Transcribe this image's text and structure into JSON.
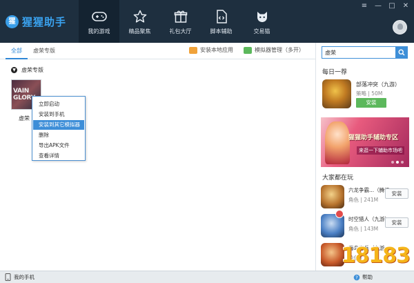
{
  "app": {
    "name": "猩猩助手",
    "logo_badge": "猩"
  },
  "nav": [
    {
      "label": "我的游戏",
      "icon": "gamepad-icon",
      "active": true
    },
    {
      "label": "精品聚焦",
      "icon": "star-icon",
      "active": false
    },
    {
      "label": "礼包大厅",
      "icon": "gift-icon",
      "active": false
    },
    {
      "label": "脚本辅助",
      "icon": "script-file-icon",
      "active": false
    },
    {
      "label": "交易猫",
      "icon": "cat-icon",
      "active": false
    }
  ],
  "window_controls": {
    "menu": "≡",
    "minimize": "—",
    "maximize": "□",
    "close": "✕"
  },
  "tabs": [
    {
      "label": "全部",
      "active": true
    },
    {
      "label": "虚荣专版",
      "active": false
    }
  ],
  "toolbar": {
    "install_local": "安装本地应用",
    "emulator_mgr": "模拟器管理（多开）"
  },
  "section": {
    "title": "虚荣专版"
  },
  "game": {
    "tile_text": "VAIN GLORY",
    "name": "虚荣"
  },
  "context_menu": [
    {
      "label": "立即启动",
      "highlighted": false
    },
    {
      "label": "安装到手机",
      "highlighted": false
    },
    {
      "label": "安装到其它模拟器",
      "highlighted": true
    },
    {
      "label": "删除",
      "highlighted": false
    },
    {
      "label": "导出APK文件",
      "highlighted": false
    },
    {
      "label": "查看详情",
      "highlighted": false
    }
  ],
  "sidebar": {
    "search_value": "虚荣",
    "daily_title": "每日一荐",
    "daily": {
      "name": "部落冲突（九游）",
      "meta": "策略 | 50M",
      "install": "安装"
    },
    "banner": {
      "title": "猩猩助手辅助专区",
      "subtitle": "来逛一下辅助市场吧"
    },
    "playing_title": "大家都在玩",
    "playing": [
      {
        "name": "六龙争霸...（腾讯",
        "meta": "角色 | 241M",
        "install": "安装",
        "color": "#b8742e"
      },
      {
        "name": "时空猎人（九游）",
        "meta": "角色 | 143M",
        "install": "安装",
        "color": "#4a7fc4"
      },
      {
        "name": "海岛奇兵（九游",
        "meta": "角色 |",
        "install": "安装",
        "color": "#c85a2a"
      }
    ]
  },
  "status": {
    "my_phone": "我的手机",
    "help": "帮助"
  },
  "watermark": "18183"
}
